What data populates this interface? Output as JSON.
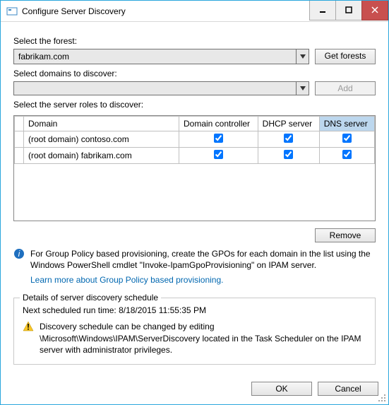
{
  "window": {
    "title": "Configure Server Discovery"
  },
  "labels": {
    "select_forest": "Select the forest:",
    "select_domains": "Select domains to discover:",
    "select_roles": "Select the server roles to discover:",
    "details_legend": "Details of server discovery schedule"
  },
  "forest_combo": {
    "value": "fabrikam.com"
  },
  "domains_combo": {
    "value": ""
  },
  "buttons": {
    "get_forests": "Get forests",
    "add": "Add",
    "remove": "Remove",
    "ok": "OK",
    "cancel": "Cancel"
  },
  "table": {
    "headers": {
      "domain": "Domain",
      "dc": "Domain controller",
      "dhcp": "DHCP server",
      "dns": "DNS server"
    },
    "rows": [
      {
        "domain": "(root domain) contoso.com",
        "dc": true,
        "dhcp": true,
        "dns": true
      },
      {
        "domain": "(root domain) fabrikam.com",
        "dc": true,
        "dhcp": true,
        "dns": true
      }
    ]
  },
  "info": {
    "text": "For Group Policy based provisioning, create the GPOs for each domain in the list using the Windows PowerShell cmdlet \"Invoke-IpamGpoProvisioning\" on IPAM server.",
    "link": "Learn more about Group Policy based provisioning."
  },
  "schedule": {
    "next_run": "Next scheduled run time: 8/18/2015 11:55:35 PM",
    "warning": "Discovery schedule can be changed by editing \\Microsoft\\Windows\\IPAM\\ServerDiscovery located in the Task Scheduler on the IPAM server with administrator privileges."
  }
}
